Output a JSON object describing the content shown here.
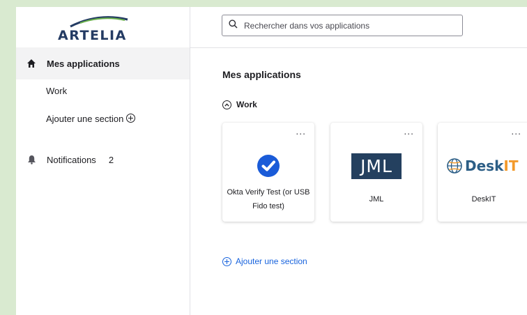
{
  "brand": {
    "logo_text": "ARTELIA"
  },
  "search": {
    "placeholder": "Rechercher dans vos applications"
  },
  "sidebar": {
    "items": [
      {
        "label": "Mes applications",
        "icon": "home-icon"
      },
      {
        "label": "Work"
      },
      {
        "label": "Ajouter une section",
        "icon": "plus-circle-icon"
      },
      {
        "label": "Notifications",
        "icon": "bell-icon",
        "count": "2"
      }
    ]
  },
  "main": {
    "title": "Mes applications",
    "section": {
      "name": "Work",
      "icon": "chevron-up-circle-icon"
    },
    "apps": [
      {
        "label": "Okta Verify Test (or USB Fido test)",
        "icon": "okta-verify-check-icon",
        "menu": "..."
      },
      {
        "label": "JML",
        "logo_text": "JML",
        "menu": "..."
      },
      {
        "label": "DeskIT",
        "logo_text_a": "Desk",
        "logo_text_b": "IT",
        "icon": "globe-icon",
        "menu": "..."
      }
    ],
    "add_section_label": "Ajouter une section"
  },
  "colors": {
    "accent": "#1662dd",
    "okta_blue": "#1a5bd8",
    "jml_navy": "#24405f",
    "deskit_blue": "#2c5e86",
    "deskit_orange": "#f39a2c",
    "brand_navy": "#243b63",
    "brand_green": "#6ab04c"
  }
}
